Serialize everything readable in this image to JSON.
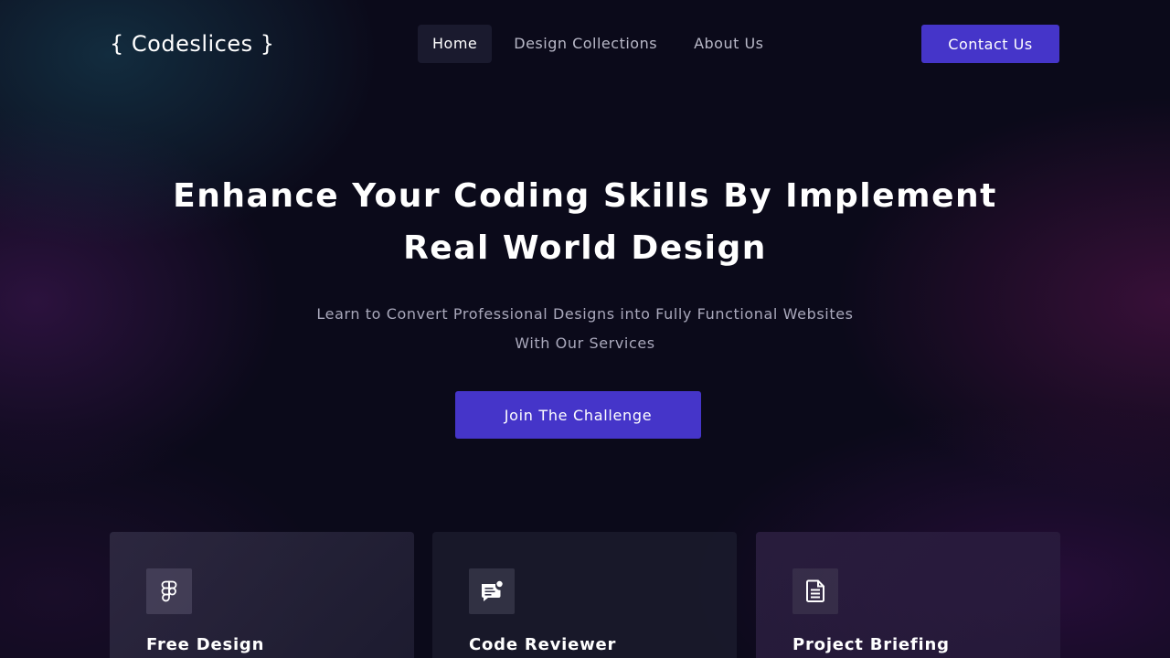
{
  "brand": {
    "logo_text": "{ Codeslices }"
  },
  "nav": {
    "items": [
      {
        "label": "Home",
        "active": true
      },
      {
        "label": "Design Collections",
        "active": false
      },
      {
        "label": "About Us",
        "active": false
      }
    ],
    "contact_label": "Contact Us"
  },
  "hero": {
    "title_line1": "Enhance Your Coding Skills By Implement",
    "title_line2": "Real World Design",
    "subtitle_line1": "Learn to Convert Professional Designs into Fully Functional Websites",
    "subtitle_line2": "With Our Services",
    "cta_label": "Join The Challenge"
  },
  "cards": [
    {
      "title": "Free Design",
      "icon": "figma-icon"
    },
    {
      "title": "Code Reviewer",
      "icon": "chat-notification-icon"
    },
    {
      "title": "Project Briefing",
      "icon": "document-icon"
    }
  ],
  "colors": {
    "background": "#0b0a1a",
    "accent": "#4535c9",
    "nav_active_bg": "#1a1a2e",
    "muted_text": "#a9a8bb"
  }
}
